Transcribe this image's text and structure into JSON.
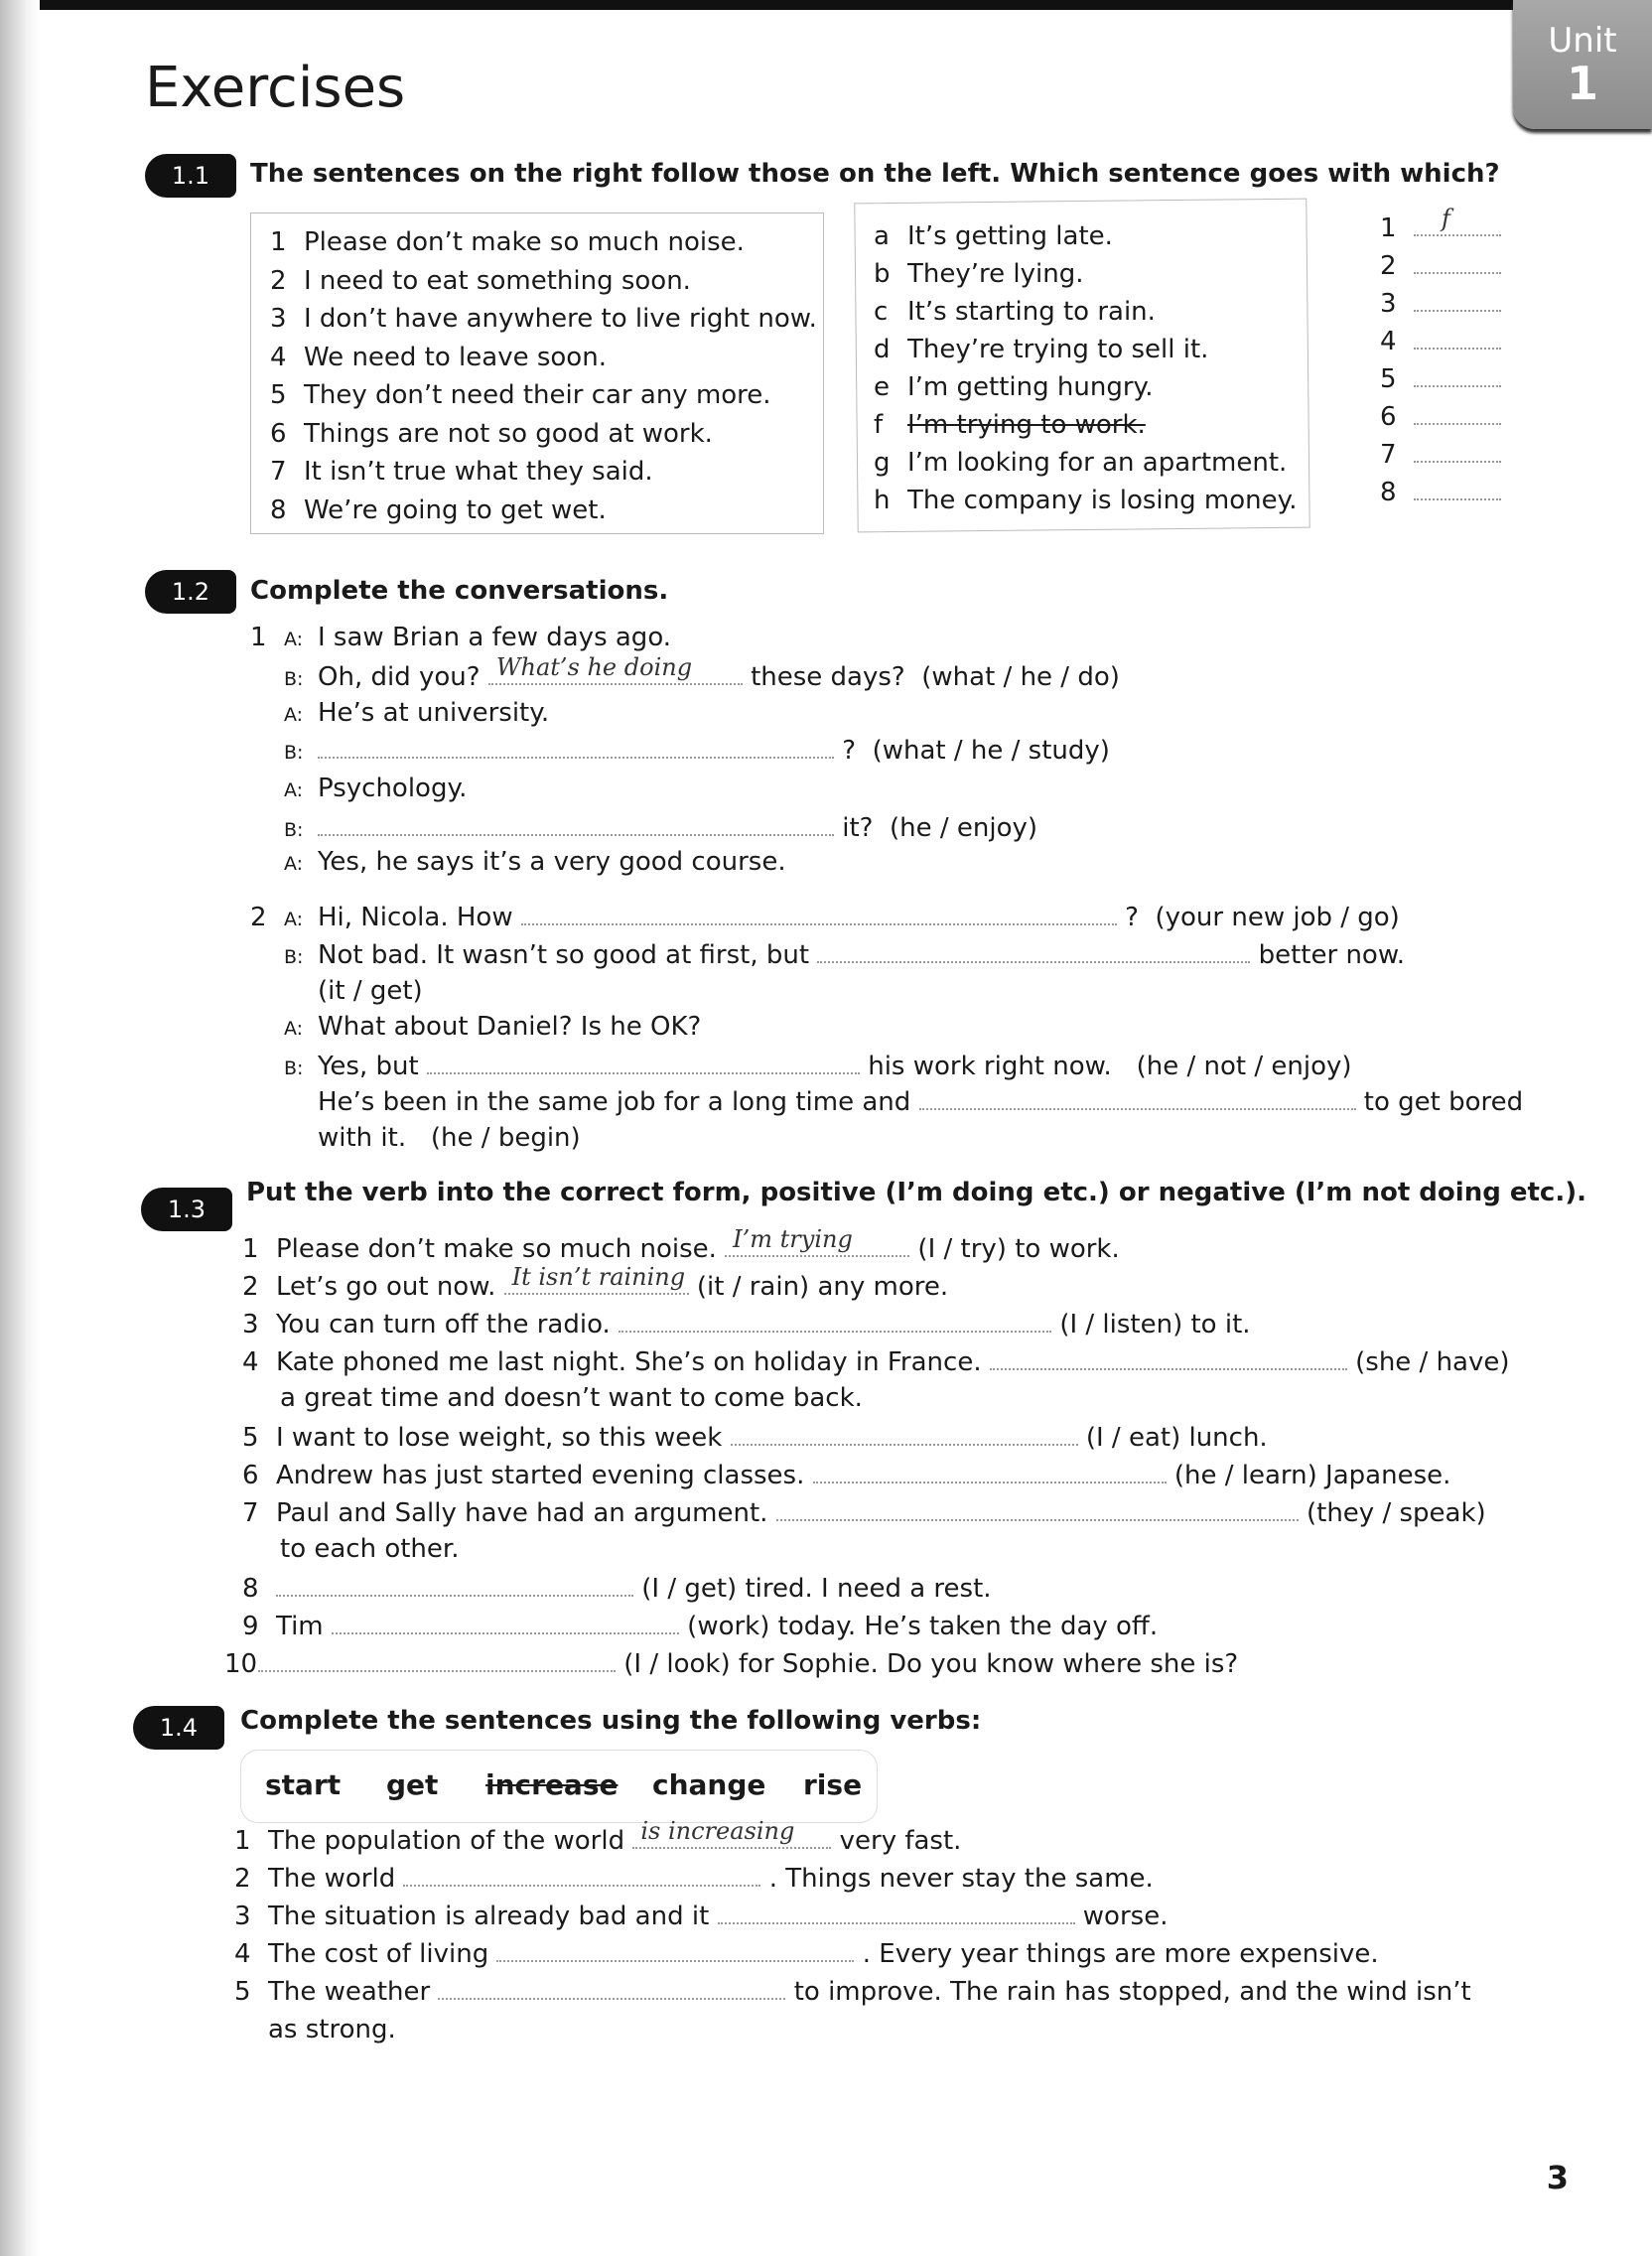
{
  "page": {
    "title": "Exercises",
    "unit_label": "Unit",
    "unit_number": "1",
    "page_number": "3"
  },
  "ex11": {
    "badge": "1.1",
    "heading": "The sentences on the right follow those on the left. Which sentence goes with which?",
    "left": [
      {
        "n": "1",
        "text": "Please don’t make so much noise."
      },
      {
        "n": "2",
        "text": "I need to eat something soon."
      },
      {
        "n": "3",
        "text": "I don’t have anywhere to live right now."
      },
      {
        "n": "4",
        "text": "We need to leave soon."
      },
      {
        "n": "5",
        "text": "They don’t need their car any more."
      },
      {
        "n": "6",
        "text": "Things are not so good at work."
      },
      {
        "n": "7",
        "text": "It isn’t true what they said."
      },
      {
        "n": "8",
        "text": "We’re going to get wet."
      }
    ],
    "right": [
      {
        "l": "a",
        "text": "It’s getting late."
      },
      {
        "l": "b",
        "text": "They’re lying."
      },
      {
        "l": "c",
        "text": "It’s starting to rain."
      },
      {
        "l": "d",
        "text": "They’re trying to sell it."
      },
      {
        "l": "e",
        "text": "I’m getting hungry."
      },
      {
        "l": "f",
        "text": "I’m trying to work.",
        "struck": true
      },
      {
        "l": "g",
        "text": "I’m looking for an apartment."
      },
      {
        "l": "h",
        "text": "The company is losing money."
      }
    ],
    "answers": [
      {
        "n": "1",
        "value": "f"
      },
      {
        "n": "2",
        "value": ""
      },
      {
        "n": "3",
        "value": ""
      },
      {
        "n": "4",
        "value": ""
      },
      {
        "n": "5",
        "value": ""
      },
      {
        "n": "6",
        "value": ""
      },
      {
        "n": "7",
        "value": ""
      },
      {
        "n": "8",
        "value": ""
      }
    ]
  },
  "ex12": {
    "badge": "1.2",
    "heading": "Complete the conversations.",
    "c1": {
      "n": "1",
      "l1": {
        "sp": "A:",
        "text": "I saw Brian a few days ago."
      },
      "l2": {
        "sp": "B:",
        "pre": "Oh, did you?",
        "answer": "What’s he doing",
        "post": "these days?",
        "hint": "(what / he / do)"
      },
      "l3": {
        "sp": "A:",
        "text": "He’s at university."
      },
      "l4": {
        "sp": "B:",
        "post": "?",
        "hint": "(what / he / study)"
      },
      "l5": {
        "sp": "A:",
        "text": "Psychology."
      },
      "l6": {
        "sp": "B:",
        "post": "it?",
        "hint": "(he / enjoy)"
      },
      "l7": {
        "sp": "A:",
        "text": "Yes, he says it’s a very good course."
      }
    },
    "c2": {
      "n": "2",
      "l1": {
        "sp": "A:",
        "pre": "Hi, Nicola.  How",
        "post": "?",
        "hint": "(your new job / go)"
      },
      "l2": {
        "sp": "B:",
        "pre": "Not bad.  It wasn’t so good at first, but",
        "post": "better now.",
        "hint": "(it / get)"
      },
      "l3": {
        "sp": "A:",
        "text": "What about Daniel?  Is he OK?"
      },
      "l4": {
        "sp": "B:",
        "pre": "Yes, but",
        "post": "his work right now.",
        "hint": "(he / not / enjoy)"
      },
      "l5": {
        "pre": "He’s been in the same job for a long time and",
        "post": "to get bored",
        "cont": "with it.",
        "hint": "(he / begin)"
      }
    }
  },
  "ex13": {
    "badge": "1.3",
    "heading_a": "Put the verb into the correct form, positive ",
    "heading_b": "(I’m doing etc.)",
    "heading_c": " or negative ",
    "heading_d": "(I’m not doing etc.).",
    "items": [
      {
        "n": "1",
        "pre": "Please don’t make so much noise.",
        "answer": "I’m trying",
        "post": "(I / try) to work."
      },
      {
        "n": "2",
        "pre": "Let’s go out now.",
        "answer": "It isn’t raining",
        "post": "(it / rain) any more."
      },
      {
        "n": "3",
        "pre": "You can turn off the radio.",
        "answer": "",
        "post": "(I / listen) to it."
      },
      {
        "n": "4",
        "pre": "Kate phoned me last night.  She’s on holiday in France.",
        "answer": "",
        "post": "(she / have)",
        "cont": "a great time and doesn’t want to come back."
      },
      {
        "n": "5",
        "pre": "I want to lose weight, so this week",
        "answer": "",
        "post": "(I / eat) lunch."
      },
      {
        "n": "6",
        "pre": "Andrew has just started evening classes.",
        "answer": "",
        "post": "(he / learn) Japanese."
      },
      {
        "n": "7",
        "pre": "Paul and Sally have had an argument.",
        "answer": "",
        "post": "(they / speak)",
        "cont": "to each other."
      },
      {
        "n": "8",
        "pre": "",
        "answer": "",
        "post": "(I / get) tired.  I need a rest."
      },
      {
        "n": "9",
        "pre": "Tim",
        "answer": "",
        "post": "(work) today.  He’s taken the day off."
      },
      {
        "n": "10",
        "pre": "",
        "answer": "",
        "post": "(I / look) for Sophie.  Do you know where she is?"
      }
    ]
  },
  "ex14": {
    "badge": "1.4",
    "heading": "Complete the sentences using the following verbs:",
    "verbs": [
      {
        "text": "start",
        "struck": false
      },
      {
        "text": "get",
        "struck": false
      },
      {
        "text": "increase",
        "struck": true
      },
      {
        "text": "change",
        "struck": false
      },
      {
        "text": "rise",
        "struck": false
      }
    ],
    "items": [
      {
        "n": "1",
        "pre": "The population of the world",
        "answer": "is increasing",
        "post": "very fast."
      },
      {
        "n": "2",
        "pre": "The world",
        "answer": "",
        "post": ". Things never stay the same."
      },
      {
        "n": "3",
        "pre": "The situation is already bad and it",
        "answer": "",
        "post": "worse."
      },
      {
        "n": "4",
        "pre": "The cost of living",
        "answer": "",
        "post": ".  Every year things are more expensive."
      },
      {
        "n": "5",
        "pre": "The weather",
        "answer": "",
        "post": "to improve.  The rain has stopped, and the wind isn’t",
        "cont": "as strong."
      }
    ]
  }
}
